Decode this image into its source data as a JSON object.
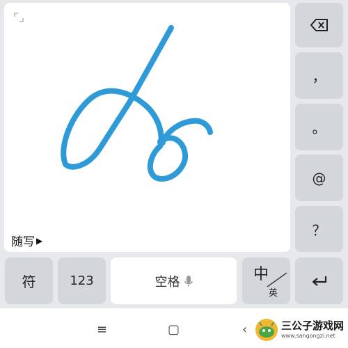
{
  "handwriting_pad": {
    "mode_label": "随写",
    "mode_arrow": "▶",
    "stroke_color": "#2e9ad8"
  },
  "right_column": {
    "backspace_icon": "backspace-icon",
    "comma": "，",
    "period": "。",
    "at": "@",
    "question": "？",
    "enter_icon": "enter-icon"
  },
  "bottom_row": {
    "symbols": "符",
    "numbers": "123",
    "space": "空格",
    "mic_icon": "mic-icon",
    "lang_zh": "中",
    "lang_en": "英"
  },
  "nav_bar": {
    "menu": "≡",
    "home": "▢",
    "back": "‹"
  },
  "watermark": {
    "title": "三公子游戏网",
    "url": "www.sangongzi.net"
  }
}
